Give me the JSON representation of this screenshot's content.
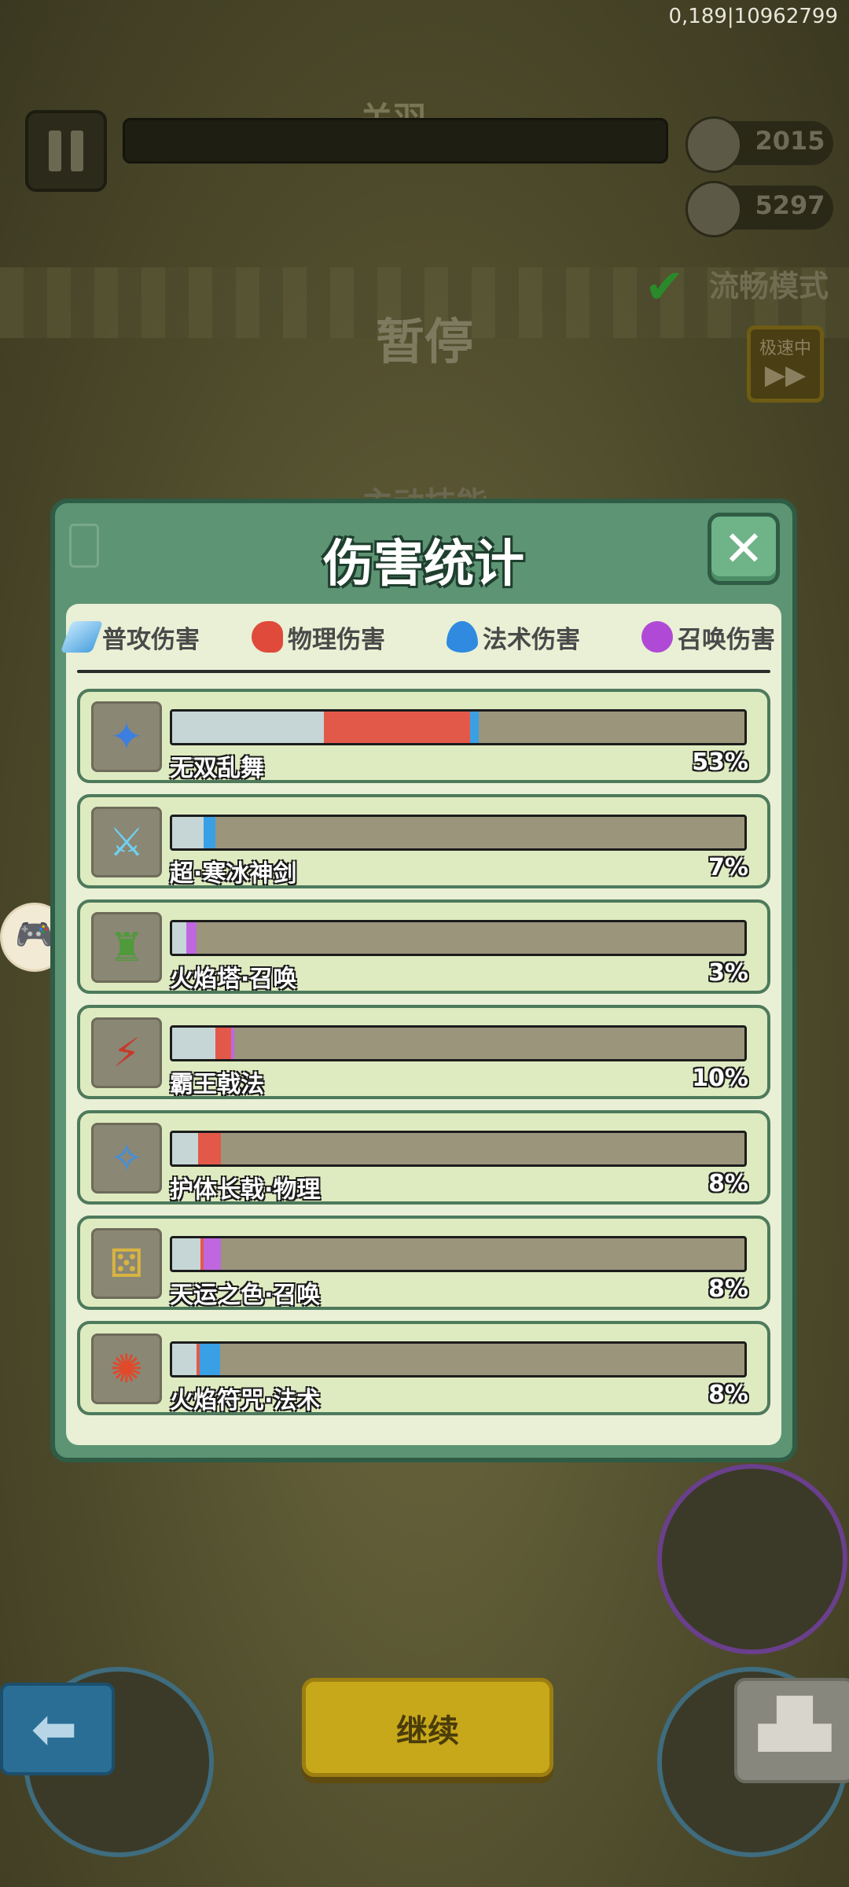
{
  "status_bar": {
    "coords": "0,189|10962799"
  },
  "hud": {
    "boss_name": "关羽",
    "coins": "2015",
    "kills": "5297",
    "smooth_mode": "流畅模式",
    "speed_label": "极速中",
    "speed_arrows": "▶▶",
    "paused_title": "暂停",
    "behind_text": "主动技能"
  },
  "modal": {
    "title": "伤害统计",
    "close": "✕",
    "tabs": [
      {
        "label": "普攻伤害",
        "icon": "sword-icon",
        "color": "#4da3e0"
      },
      {
        "label": "物理伤害",
        "icon": "fist-icon",
        "color": "#e04a3a"
      },
      {
        "label": "法术伤害",
        "icon": "flame-icon",
        "color": "#2f8ae0"
      },
      {
        "label": "召唤伤害",
        "icon": "paw-icon",
        "color": "#b04ad6"
      }
    ],
    "skills": [
      {
        "name": "无双乱舞",
        "pct": "53%",
        "icon": "ice-burst-icon",
        "glyph": "✦",
        "glyph_color": "#3d7fe0",
        "segments": [
          {
            "type": "basic",
            "value": 26.5
          },
          {
            "type": "physical",
            "value": 25.5
          },
          {
            "type": "magic",
            "value": 1.5
          }
        ]
      },
      {
        "name": "超·寒冰神剑",
        "pct": "7%",
        "icon": "ice-sword-icon",
        "glyph": "⚔",
        "glyph_color": "#6fd0f0",
        "segments": [
          {
            "type": "basic",
            "value": 5.5
          },
          {
            "type": "magic",
            "value": 2.0
          }
        ]
      },
      {
        "name": "火焰塔·召唤",
        "pct": "3%",
        "icon": "fire-tower-icon",
        "glyph": "♜",
        "glyph_color": "#4f9a3a",
        "segments": [
          {
            "type": "basic",
            "value": 2.5
          },
          {
            "type": "summon",
            "value": 1.8
          }
        ]
      },
      {
        "name": "霸王戟法",
        "pct": "10%",
        "icon": "halberd-icon",
        "glyph": "⚡",
        "glyph_color": "#c63a2a",
        "segments": [
          {
            "type": "basic",
            "value": 7.5
          },
          {
            "type": "physical",
            "value": 2.8
          },
          {
            "type": "summon",
            "value": 0.6
          }
        ]
      },
      {
        "name": "护体长戟·物理",
        "pct": "8%",
        "icon": "guard-halberd-icon",
        "glyph": "✧",
        "glyph_color": "#3f8fe0",
        "segments": [
          {
            "type": "basic",
            "value": 4.5
          },
          {
            "type": "physical",
            "value": 4.0
          }
        ]
      },
      {
        "name": "天运之色·召唤",
        "pct": "8%",
        "icon": "dice-icon",
        "glyph": "⚄",
        "glyph_color": "#d8b440",
        "segments": [
          {
            "type": "basic",
            "value": 5.0
          },
          {
            "type": "physical",
            "value": 0.6
          },
          {
            "type": "summon",
            "value": 3.0
          }
        ]
      },
      {
        "name": "火焰符咒·法术",
        "pct": "8%",
        "icon": "fire-scroll-icon",
        "glyph": "✺",
        "glyph_color": "#e0492a",
        "segments": [
          {
            "type": "basic",
            "value": 4.2
          },
          {
            "type": "physical",
            "value": 0.5
          },
          {
            "type": "magic",
            "value": 3.6
          }
        ]
      }
    ],
    "segment_colors": {
      "basic": "#c6d6d6",
      "physical": "#e2594a",
      "magic": "#3aa0e6",
      "summon": "#c067e0"
    }
  },
  "buttons": {
    "back": "⬅",
    "continue": "继续",
    "rank": "▟▙"
  },
  "side": {
    "gamepad": "🎮"
  }
}
